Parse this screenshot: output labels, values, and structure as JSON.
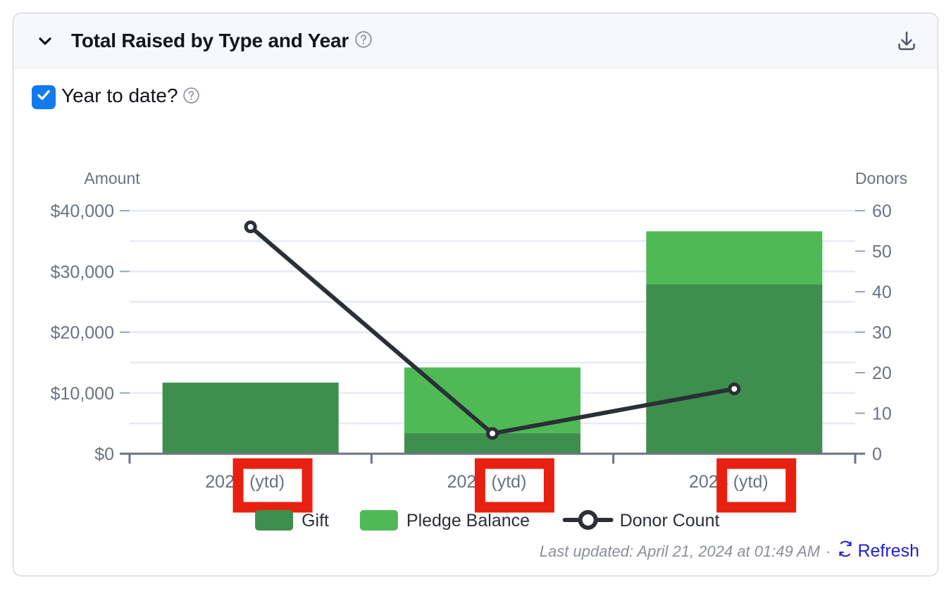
{
  "card": {
    "header": {
      "collapse_icon": "chevron-down-icon",
      "title": "Total Raised by Type and Year",
      "help_icon": "question-circle-icon",
      "download_icon": "download-icon"
    },
    "controls": {
      "checkbox_checked": true,
      "checkbox_label": "Year to date?",
      "help_icon": "question-circle-icon"
    },
    "footer": {
      "last_updated": "Last updated: April 21, 2024 at 01:49 AM",
      "separator": "·",
      "refresh_label": "Refresh",
      "refresh_icon": "refresh-icon"
    }
  },
  "colors": {
    "gift": "#3e8e4e",
    "pledge_balance": "#4fba55",
    "donor_line": "#2b2f36",
    "checkbox_accent": "#117aec",
    "link": "#2020d8",
    "annotation": "#e82010",
    "grid": "#e6eaf5",
    "axis": "#6b7280"
  },
  "chart_data": {
    "type": "bar",
    "title": "Total Raised by Type and Year",
    "categories": [
      "2022 (ytd)",
      "2023 (ytd)",
      "2024 (ytd)"
    ],
    "category_base": [
      "2022",
      "2023",
      "2024"
    ],
    "category_suffix": [
      "(ytd)",
      "(ytd)",
      "(ytd)"
    ],
    "stacked": true,
    "grid": true,
    "legend_position": "bottom",
    "xlabel": "",
    "ylabel": "Amount",
    "y2label": "Donors",
    "ylim": [
      0,
      40000
    ],
    "yticks": [
      0,
      10000,
      20000,
      30000,
      40000
    ],
    "ytick_labels": [
      "$0",
      "$10,000",
      "$20,000",
      "$30,000",
      "$40,000"
    ],
    "y_minor_step": 5000,
    "y2lim": [
      0,
      60
    ],
    "y2ticks": [
      0,
      10,
      20,
      30,
      40,
      50,
      60
    ],
    "y2tick_labels": [
      "0",
      "10",
      "20",
      "30",
      "40",
      "50",
      "60"
    ],
    "series": [
      {
        "name": "Gift",
        "type": "bar",
        "axis": "left",
        "color": "#3e8e4e",
        "values": [
          11700,
          3400,
          27900
        ]
      },
      {
        "name": "Pledge Balance",
        "type": "bar",
        "axis": "left",
        "color": "#4fba55",
        "values": [
          0,
          10800,
          8700
        ]
      },
      {
        "name": "Donor Count",
        "type": "line",
        "axis": "right",
        "color": "#2b2f36",
        "values": [
          56,
          5,
          16
        ]
      }
    ],
    "totals": [
      11700,
      14200,
      36600
    ],
    "annotations": [
      {
        "name": "ytd-highlight-2022",
        "target": "x-tick-suffix-2022",
        "shape": "rect",
        "color": "#e82010"
      },
      {
        "name": "ytd-highlight-2023",
        "target": "x-tick-suffix-2023",
        "shape": "rect",
        "color": "#e82010"
      },
      {
        "name": "ytd-highlight-2024",
        "target": "x-tick-suffix-2024",
        "shape": "rect",
        "color": "#e82010"
      }
    ],
    "legend": [
      {
        "label": "Gift",
        "marker": "square",
        "color": "#3e8e4e"
      },
      {
        "label": "Pledge Balance",
        "marker": "square",
        "color": "#4fba55"
      },
      {
        "label": "Donor Count",
        "marker": "line-circle",
        "color": "#2b2f36"
      }
    ]
  }
}
